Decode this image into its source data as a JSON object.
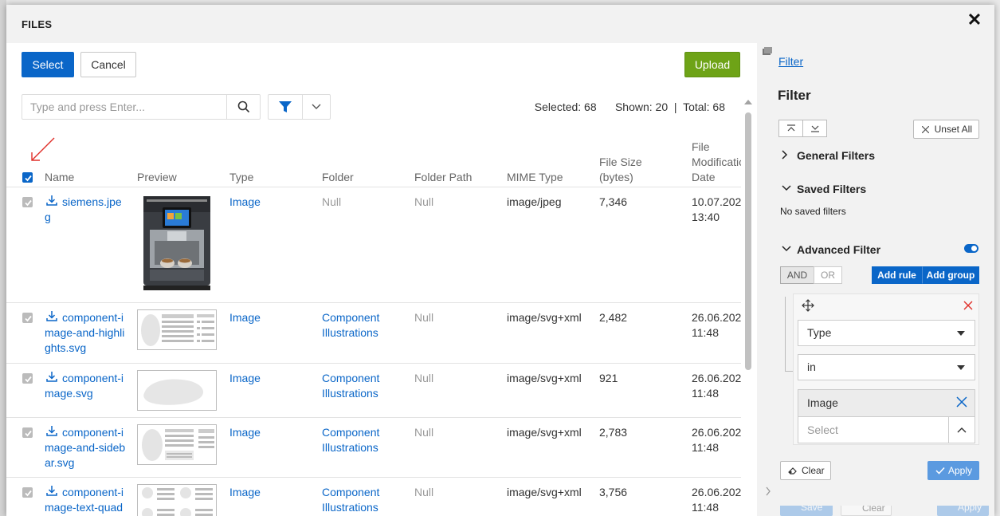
{
  "modal": {
    "title": "FILES",
    "close": "✕"
  },
  "toolbar": {
    "select_label": "Select",
    "cancel_label": "Cancel",
    "upload_label": "Upload"
  },
  "search": {
    "placeholder": "Type and press Enter...",
    "value": ""
  },
  "counts": {
    "text": "Selected: 68      Shown: 20  |  Total: 68"
  },
  "columns": {
    "name": "Name",
    "preview": "Preview",
    "type": "Type",
    "folder": "Folder",
    "folder_path": "Folder Path",
    "mime": "MIME Type",
    "size_line1": "File Size",
    "size_line2": "(bytes)",
    "date_line1": "File",
    "date_line2": "Modificatio",
    "date_line3": "Date"
  },
  "rows": [
    {
      "name": "siemens.jpeg",
      "type": "Image",
      "folder": "Null",
      "folder_path": "Null",
      "mime": "image/jpeg",
      "size": "7,346",
      "date": "10.07.202",
      "time": "13:40"
    },
    {
      "name": "component-image-and-highlights.svg",
      "type": "Image",
      "folder": "Component Illustrations",
      "folder_path": "Null",
      "mime": "image/svg+xml",
      "size": "2,482",
      "date": "26.06.202",
      "time": "11:48"
    },
    {
      "name": "component-image.svg",
      "type": "Image",
      "folder": "Component Illustrations",
      "folder_path": "Null",
      "mime": "image/svg+xml",
      "size": "921",
      "date": "26.06.202",
      "time": "11:48"
    },
    {
      "name": "component-image-and-sidebar.svg",
      "type": "Image",
      "folder": "Component Illustrations",
      "folder_path": "Null",
      "mime": "image/svg+xml",
      "size": "2,783",
      "date": "26.06.202",
      "time": "11:48"
    },
    {
      "name": "component-image-text-quad",
      "type": "Image",
      "folder": "Component Illustrations",
      "folder_path": "Null",
      "mime": "image/svg+xml",
      "size": "3,756",
      "date": "26.06.202",
      "time": "11:48"
    }
  ],
  "sidebar": {
    "link": "Filter",
    "title": "Filter",
    "unset_all": "Unset All",
    "general_filters": "General Filters",
    "saved_filters": "Saved Filters",
    "no_saved": "No saved filters",
    "advanced_filter": "Advanced Filter",
    "and_label": "AND",
    "or_label": "OR",
    "add_rule": "Add rule",
    "add_group": "Add group",
    "rule": {
      "field": "Type",
      "operator": "in",
      "tag": "Image",
      "select_placeholder": "Select"
    },
    "clear": "Clear",
    "apply": "Apply",
    "ghost_save": "Save",
    "ghost_clear": "Clear",
    "ghost_apply": "Apply"
  },
  "colors": {
    "primary": "#0a66c8",
    "upload": "#6ea317",
    "apply": "#5b9ae0",
    "annotation_arrow": "#e0302a"
  }
}
